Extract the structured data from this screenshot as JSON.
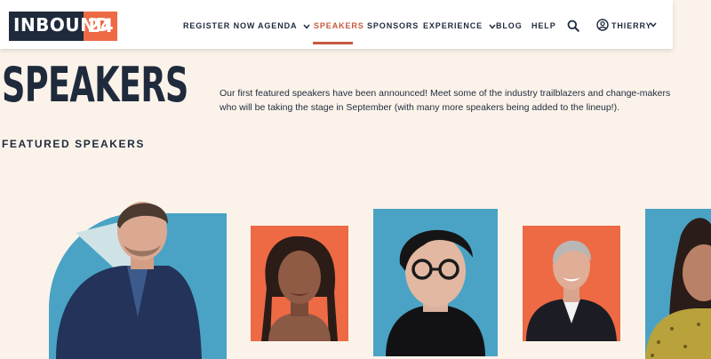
{
  "logo": {
    "word": "INBOUND",
    "number": "24"
  },
  "nav": {
    "items": [
      {
        "label": "REGISTER NOW",
        "has_dropdown": false,
        "active": false
      },
      {
        "label": "AGENDA",
        "has_dropdown": true,
        "active": false
      },
      {
        "label": "SPEAKERS",
        "has_dropdown": false,
        "active": true
      },
      {
        "label": "SPONSORS",
        "has_dropdown": false,
        "active": false
      },
      {
        "label": "EXPERIENCE",
        "has_dropdown": true,
        "active": false
      },
      {
        "label": "BLOG",
        "has_dropdown": false,
        "active": false
      },
      {
        "label": "HELP",
        "has_dropdown": false,
        "active": false
      }
    ],
    "search_icon": "search-icon",
    "user_icon": "user-circle-icon",
    "user_name": "THIERRY"
  },
  "page": {
    "title": "SPEAKERS",
    "intro": "Our first featured speakers have been announced! Meet some of the industry trailblazers and change-makers who will be taking the stage in September (with many more speakers being added to the lineup!).",
    "featured_heading": "FEATURED SPEAKERS"
  },
  "colors": {
    "background": "#fbf3ea",
    "navy": "#1f2a3c",
    "orange": "#ee6a45",
    "accent_active": "#c65a3c",
    "teal": "#4aa3c4"
  },
  "speakers": [
    {
      "backdrop": "teal-abstract"
    },
    {
      "backdrop": "orange"
    },
    {
      "backdrop": "teal"
    },
    {
      "backdrop": "orange"
    },
    {
      "backdrop": "teal"
    }
  ]
}
